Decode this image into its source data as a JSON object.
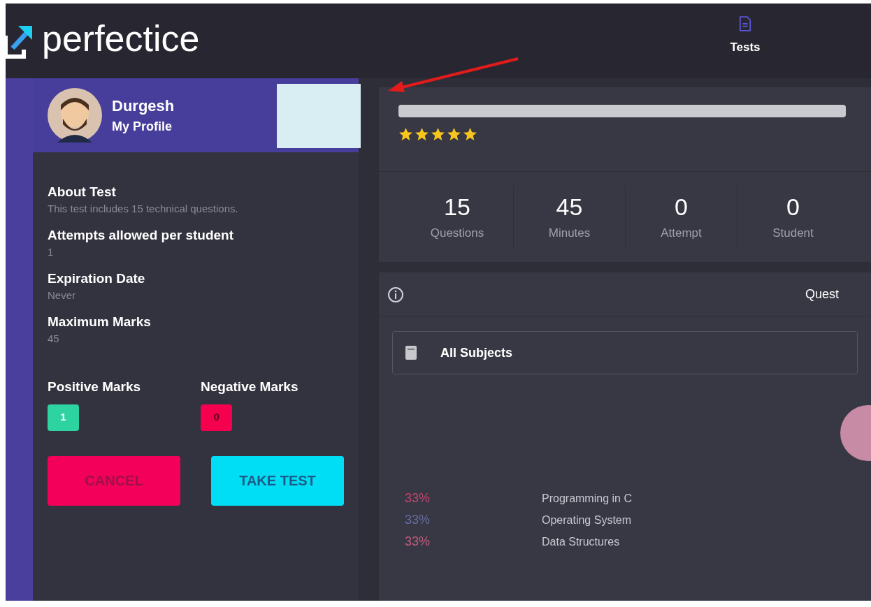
{
  "header": {
    "logo": "perfectice",
    "nav": [
      {
        "label": "Tests",
        "selected": true
      }
    ]
  },
  "profile": {
    "name": "Durgesh",
    "link": "My Profile"
  },
  "details": [
    {
      "label": "About Test",
      "value": "This test includes 15 technical questions."
    },
    {
      "label": "Attempts allowed per student",
      "value": "1"
    },
    {
      "label": "Expiration Date",
      "value": "Never"
    },
    {
      "label": "Maximum Marks",
      "value": "45"
    }
  ],
  "marks": [
    {
      "label": "Positive Marks",
      "value": "1",
      "color": "#2ed3a2"
    },
    {
      "label": "Negative Marks",
      "value": "0",
      "color": "#f5004f"
    }
  ],
  "buttons": [
    {
      "label": "CANCEL",
      "kind": "cancel"
    },
    {
      "label": "TAKE TEST",
      "kind": "primary"
    }
  ],
  "test": {
    "stars": 5,
    "stats": [
      {
        "value": "15",
        "label": "Questions"
      },
      {
        "value": "45",
        "label": "Minutes"
      },
      {
        "value": "0",
        "label": "Attempt"
      },
      {
        "value": "0",
        "label": "Student"
      }
    ]
  },
  "questions_panel": {
    "heading": "Quest",
    "subject_select": "All Subjects",
    "legend": [
      {
        "percent": "33%",
        "subject": "Programming in C",
        "color": "#c2456f"
      },
      {
        "percent": "33%",
        "subject": "Operating System",
        "color": "#686ea0"
      },
      {
        "percent": "33%",
        "subject": "Data Structures",
        "color": "#c25c7e"
      }
    ]
  }
}
